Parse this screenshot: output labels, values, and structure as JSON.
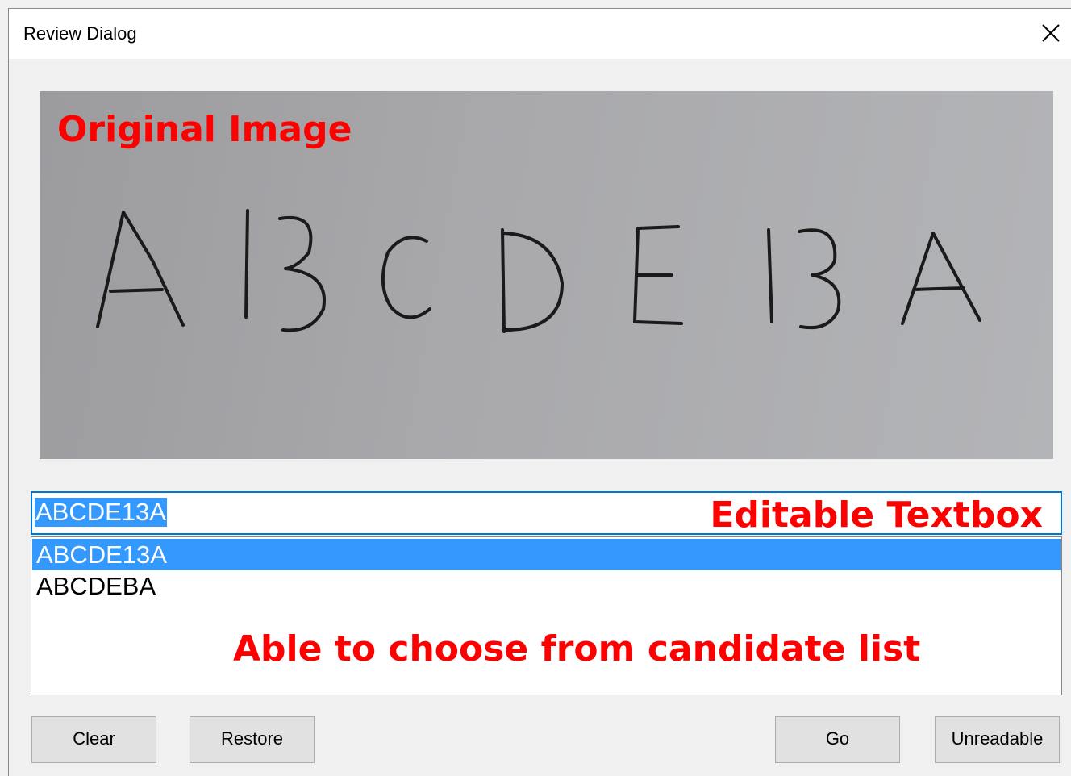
{
  "window": {
    "title": "Review Dialog",
    "close_icon": "close-icon"
  },
  "image_panel": {
    "overlay_label": "Original Image",
    "content": "handwritten-letters-image",
    "label_color": "#ff0000"
  },
  "textbox": {
    "value": "ABCDE13A",
    "selected": true,
    "overlay_label": "Editable Textbox"
  },
  "candidate_list": {
    "items": [
      "ABCDE13A",
      "ABCDEBA"
    ],
    "selected_index": 0,
    "overlay_label": "Able to choose from candidate list",
    "selection_color": "#3399ff"
  },
  "buttons": {
    "clear": "Clear",
    "restore": "Restore",
    "go": "Go",
    "unreadable": "Unreadable"
  }
}
